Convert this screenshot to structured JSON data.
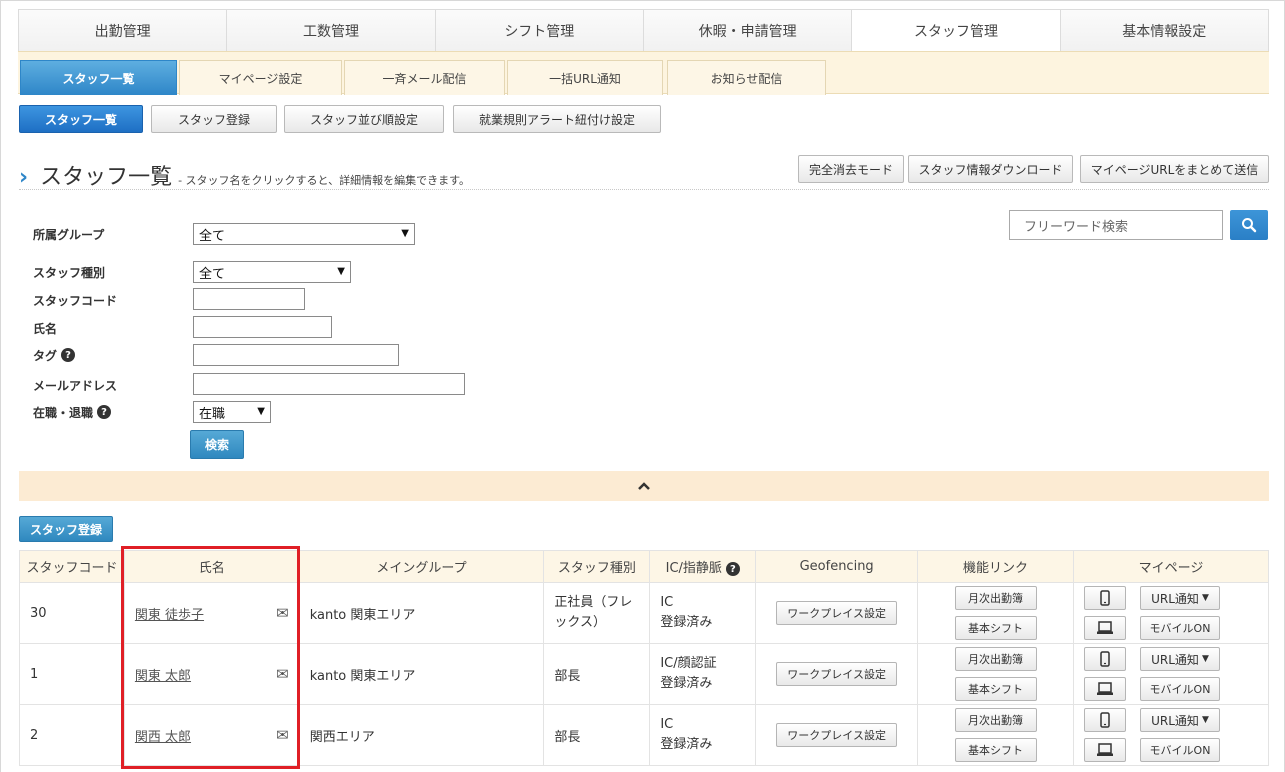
{
  "main_nav": [
    "出勤管理",
    "工数管理",
    "シフト管理",
    "休暇・申請管理",
    "スタッフ管理",
    "基本情報設定"
  ],
  "sub_nav": [
    "スタッフ一覧",
    "マイページ設定",
    "一斉メール配信",
    "一括URL通知",
    "お知らせ配信"
  ],
  "action_buttons": [
    "スタッフ一覧",
    "スタッフ登録",
    "スタッフ並び順設定",
    "就業規則アラート紐付け設定"
  ],
  "page_title": "スタッフ一覧",
  "page_subtitle": "- スタッフ名をクリックすると、詳細情報を編集できます。",
  "top_right_buttons": [
    "完全消去モード",
    "スタッフ情報ダウンロード",
    "マイページURLをまとめて送信"
  ],
  "search": {
    "placeholder": "フリーワード検索"
  },
  "filters": {
    "group_label": "所属グループ",
    "group_value": "全て",
    "type_label": "スタッフ種別",
    "type_value": "全て",
    "code_label": "スタッフコード",
    "name_label": "氏名",
    "tag_label": "タグ",
    "email_label": "メールアドレス",
    "status_label": "在職・退職",
    "status_value": "在職",
    "search_button": "検索"
  },
  "register_button": "スタッフ登録",
  "table": {
    "headers": [
      "スタッフコード",
      "氏名",
      "メイングループ",
      "スタッフ種別",
      "IC/指静脈",
      "Geofencing",
      "機能リンク",
      "マイページ"
    ],
    "workplace_button": "ワークプレイス設定",
    "link_monthly": "月次出勤簿",
    "link_shift": "基本シフト",
    "url_notify": "URL通知",
    "mobile_on": "モバイルON",
    "rows": [
      {
        "code": "30",
        "name": "関東 徒歩子",
        "group": "kanto 関東エリア",
        "type": "正社員（フレックス）",
        "ic1": "IC",
        "ic2": "登録済み"
      },
      {
        "code": "1",
        "name": "関東 太郎",
        "group": "kanto 関東エリア",
        "type": "部長",
        "ic1": "IC/顔認証",
        "ic2": "登録済み"
      },
      {
        "code": "2",
        "name": "関西 太郎",
        "group": "関西エリア",
        "type": "部長",
        "ic1": "IC",
        "ic2": "登録済み"
      }
    ]
  },
  "colors": {
    "accent": "#2e86c8",
    "highlight": "#e01f26",
    "subnav_bg": "#fdf4df"
  }
}
